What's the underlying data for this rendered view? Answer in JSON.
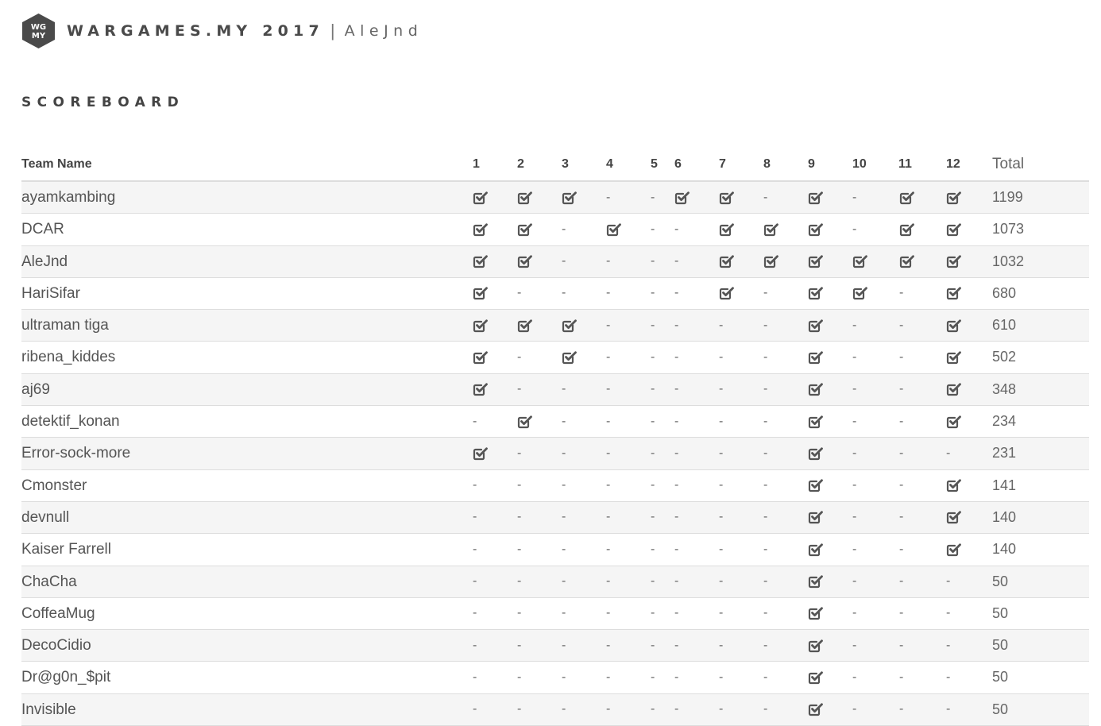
{
  "header": {
    "logo_text": "WGMY",
    "brand": "WARGAMES.MY 2017",
    "separator": "|",
    "user": "AleJnd"
  },
  "title": "SCOREBOARD",
  "table": {
    "team_header": "Team Name",
    "challenge_headers": [
      "1",
      "2",
      "3",
      "4",
      "5",
      "6",
      "7",
      "8",
      "9",
      "10",
      "11",
      "12"
    ],
    "total_header": "Total",
    "solved_icon": "check-square-icon",
    "unsolved_mark": "-",
    "rows": [
      {
        "team": "ayamkambing",
        "solved": [
          1,
          1,
          1,
          0,
          0,
          1,
          1,
          0,
          1,
          0,
          1,
          1
        ],
        "total": "1199"
      },
      {
        "team": "DCAR",
        "solved": [
          1,
          1,
          0,
          1,
          0,
          0,
          1,
          1,
          1,
          0,
          1,
          1
        ],
        "total": "1073"
      },
      {
        "team": "AleJnd",
        "solved": [
          1,
          1,
          0,
          0,
          0,
          0,
          1,
          1,
          1,
          1,
          1,
          1
        ],
        "total": "1032"
      },
      {
        "team": "HariSifar",
        "solved": [
          1,
          0,
          0,
          0,
          0,
          0,
          1,
          0,
          1,
          1,
          0,
          1
        ],
        "total": "680"
      },
      {
        "team": "ultraman tiga",
        "solved": [
          1,
          1,
          1,
          0,
          0,
          0,
          0,
          0,
          1,
          0,
          0,
          1
        ],
        "total": "610"
      },
      {
        "team": "ribena_kiddes",
        "solved": [
          1,
          0,
          1,
          0,
          0,
          0,
          0,
          0,
          1,
          0,
          0,
          1
        ],
        "total": "502"
      },
      {
        "team": "aj69",
        "solved": [
          1,
          0,
          0,
          0,
          0,
          0,
          0,
          0,
          1,
          0,
          0,
          1
        ],
        "total": "348"
      },
      {
        "team": "detektif_konan",
        "solved": [
          0,
          1,
          0,
          0,
          0,
          0,
          0,
          0,
          1,
          0,
          0,
          1
        ],
        "total": "234"
      },
      {
        "team": "Error-sock-more",
        "solved": [
          1,
          0,
          0,
          0,
          0,
          0,
          0,
          0,
          1,
          0,
          0,
          0
        ],
        "total": "231"
      },
      {
        "team": "Cmonster",
        "solved": [
          0,
          0,
          0,
          0,
          0,
          0,
          0,
          0,
          1,
          0,
          0,
          1
        ],
        "total": "141"
      },
      {
        "team": "devnull",
        "solved": [
          0,
          0,
          0,
          0,
          0,
          0,
          0,
          0,
          1,
          0,
          0,
          1
        ],
        "total": "140"
      },
      {
        "team": "Kaiser Farrell",
        "solved": [
          0,
          0,
          0,
          0,
          0,
          0,
          0,
          0,
          1,
          0,
          0,
          1
        ],
        "total": "140"
      },
      {
        "team": "ChaCha",
        "solved": [
          0,
          0,
          0,
          0,
          0,
          0,
          0,
          0,
          1,
          0,
          0,
          0
        ],
        "total": "50"
      },
      {
        "team": "CoffeaMug",
        "solved": [
          0,
          0,
          0,
          0,
          0,
          0,
          0,
          0,
          1,
          0,
          0,
          0
        ],
        "total": "50"
      },
      {
        "team": "DecoCidio",
        "solved": [
          0,
          0,
          0,
          0,
          0,
          0,
          0,
          0,
          1,
          0,
          0,
          0
        ],
        "total": "50"
      },
      {
        "team": "Dr@g0n_$pit",
        "solved": [
          0,
          0,
          0,
          0,
          0,
          0,
          0,
          0,
          1,
          0,
          0,
          0
        ],
        "total": "50"
      },
      {
        "team": "Invisible",
        "solved": [
          0,
          0,
          0,
          0,
          0,
          0,
          0,
          0,
          1,
          0,
          0,
          0
        ],
        "total": "50"
      }
    ]
  }
}
